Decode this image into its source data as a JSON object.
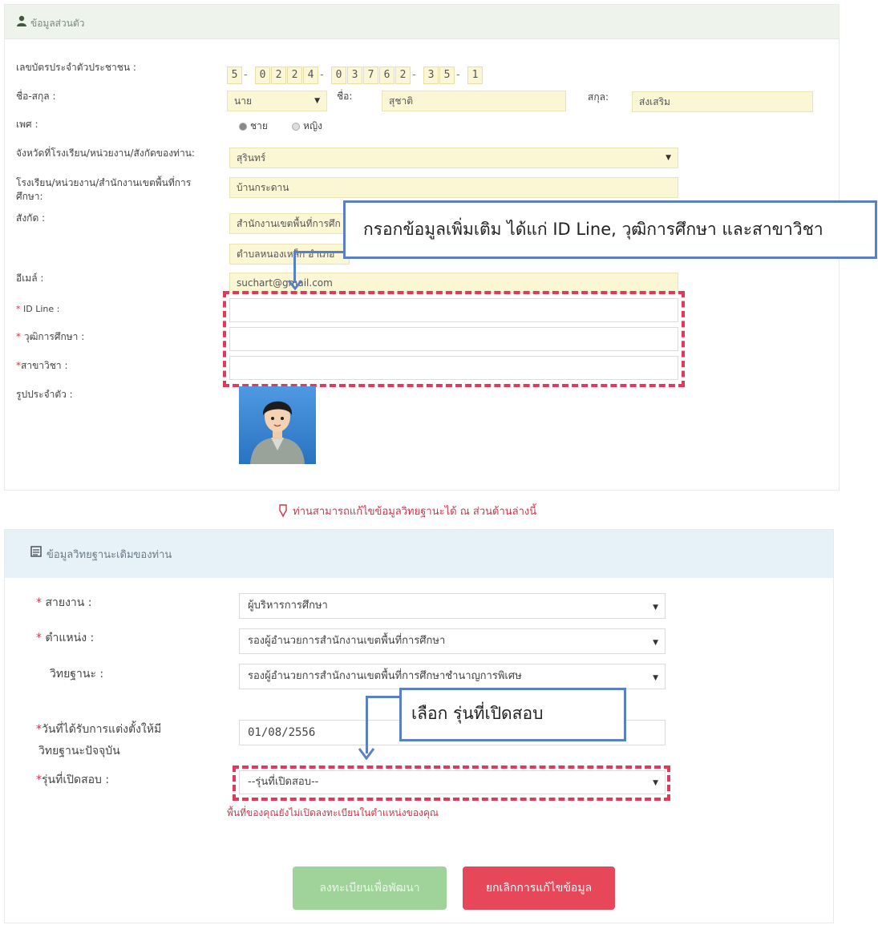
{
  "personal": {
    "section_title": "ข้อมูลส่วนตัว",
    "labels": {
      "citizen_id": "เลขบัตรประจำตัวประชาชน :",
      "name": "ชื่อ-สกุล :",
      "gender": "เพศ :",
      "province": "จังหวัดที่โรงเรียน/หน่วยงาน/สังกัดของท่าน:",
      "school_line1": "โรงเรียน/หน่วยงาน/สำนักงานเขตพื้นที่การ",
      "school_line2": "ศึกษา:",
      "affiliation": "สังกัด :",
      "email": "อีเมล์ :",
      "id_line": "ID Line :",
      "education": "วุฒิการศึกษา :",
      "major": "สาขาวิชา :",
      "photo": "รูปประจำตัว :"
    },
    "citizen_id_digits": [
      "5",
      "0",
      "2",
      "2",
      "4",
      "0",
      "3",
      "7",
      "6",
      "2",
      "3",
      "5",
      "1"
    ],
    "title_value": "นาย",
    "first_name_label": "ชื่อ:",
    "first_name_value": "สุชาติ",
    "last_name_label": "สกุล:",
    "last_name_value": "ส่งเสริม",
    "gender_male": "ชาย",
    "gender_female": "หญิง",
    "province_value": "สุรินทร์",
    "school_value": "บ้านกระดาน",
    "affiliation_value1": "สำนักงานเขตพื้นที่การศึก",
    "affiliation_value2": "ตำบลหนองเหล็ก อำเภอ",
    "email_value": "suchart@gmail.com",
    "id_line_value": "",
    "education_value": "",
    "major_value": ""
  },
  "callout_top": "กรอกข้อมูลเพิ่มเติม ได้แก่ ID Line, วุฒิการศึกษา และสาขาวิชา",
  "notice": "ท่านสามารถแก้ไขข้อมูลวิทยฐานะได้ ณ ส่วนด้านล่างนี้",
  "rank": {
    "section_title": "ข้อมูลวิทยฐานะเดิมของท่าน",
    "labels": {
      "line_of_work": "สายงาน :",
      "position": "ตำแหน่ง :",
      "academic_rank": "วิทยฐานะ :",
      "appointed_line1": "วันที่ได้รับการแต่งตั้งให้มี",
      "appointed_line2": "วิทยฐานะปัจจุบัน",
      "exam_round": "รุ่นที่เปิดสอบ :"
    },
    "line_of_work_value": "ผู้บริหารการศึกษา",
    "position_value": "รองผู้อำนวยการสำนักงานเขตพื้นที่การศึกษา",
    "academic_rank_value": "รองผู้อำนวยการสำนักงานเขตพื้นที่การศึกษาชำนาญการพิเศษ",
    "appointed_value": "01/08/2556",
    "exam_round_value": "--รุ่นที่เปิดสอบ--",
    "error_text": "พื้นที่ของคุณยังไม่เปิดลงทะเบียนในตำแหน่งของคุณ"
  },
  "callout_bottom": "เลือก รุ่นที่เปิดสอบ",
  "buttons": {
    "register": "ลงทะเบียนเพื่อพัฒนา",
    "cancel": "ยกเลิกการแก้ไขข้อมูล"
  },
  "colors": {
    "required": "#d6324a",
    "callout_border": "#5b7fc6",
    "register_btn": "#9fd39a",
    "cancel_btn": "#e6485a"
  }
}
